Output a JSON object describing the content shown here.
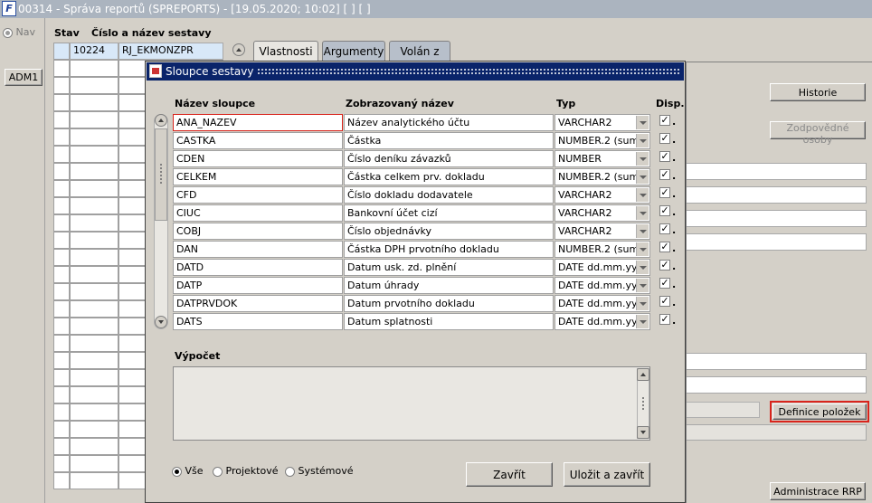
{
  "window": {
    "logo_text": "F",
    "title": "00314 - Správa reportů (SPREPORTS) - [19.05.2020; 10:02]  [ ]  [ ]"
  },
  "leftnav": {
    "nav_label": "Nav",
    "adm_button": "ADM1"
  },
  "report": {
    "col_stav": "Stav",
    "col_cislo": "Číslo a název sestavy",
    "number": "10224",
    "name": "RJ_EKMONZPR"
  },
  "tabs": [
    {
      "label": "Vlastnosti",
      "active": true
    },
    {
      "label": "Argumenty",
      "active": false
    },
    {
      "label": "Volán z",
      "active": false
    }
  ],
  "right_buttons": {
    "historie": "Historie",
    "zodpovedne": "Zodpovědné osoby",
    "definice": "Definice položek",
    "administrace": "Administrace RRP"
  },
  "dialog": {
    "title": "Sloupce sestavy",
    "headers": {
      "nazev": "Název sloupce",
      "zobrazovany": "Zobrazovaný název",
      "typ": "Typ",
      "disp": "Disp."
    },
    "rows": [
      {
        "col": "ANA_NAZEV",
        "label": "Název analytického účtu",
        "type": "VARCHAR2",
        "disp": true
      },
      {
        "col": "CASTKA",
        "label": "Částka",
        "type": "NUMBER.2  (sum)",
        "disp": true
      },
      {
        "col": "CDEN",
        "label": "Číslo deníku závazků",
        "type": "NUMBER",
        "disp": true
      },
      {
        "col": "CELKEM",
        "label": "Částka celkem prv. dokladu",
        "type": "NUMBER.2  (sum)",
        "disp": true
      },
      {
        "col": "CFD",
        "label": "Číslo dokladu dodavatele",
        "type": "VARCHAR2",
        "disp": true
      },
      {
        "col": "CIUC",
        "label": "Bankovní účet cizí",
        "type": "VARCHAR2",
        "disp": true
      },
      {
        "col": "COBJ",
        "label": "Číslo objednávky",
        "type": "VARCHAR2",
        "disp": true
      },
      {
        "col": "DAN",
        "label": "Částka DPH prvotního dokladu",
        "type": "NUMBER.2  (sum)",
        "disp": true
      },
      {
        "col": "DATD",
        "label": "Datum usk. zd. plnění",
        "type": "DATE dd.mm.yy...",
        "disp": true
      },
      {
        "col": "DATP",
        "label": "Datum úhrady",
        "type": "DATE dd.mm.yy...",
        "disp": true
      },
      {
        "col": "DATPRVDOK",
        "label": "Datum prvotního dokladu",
        "type": "DATE dd.mm.yy...",
        "disp": true
      },
      {
        "col": "DATS",
        "label": "Datum splatnosti",
        "type": "DATE dd.mm.yy...",
        "disp": true
      }
    ],
    "vypocet_label": "Výpočet",
    "vypocet_value": "",
    "filters": [
      {
        "label": "Vše",
        "selected": true
      },
      {
        "label": "Projektové",
        "selected": false
      },
      {
        "label": "Systémové",
        "selected": false
      }
    ],
    "zavrit": "Zavřít",
    "ulozit": "Uložit a zavřít"
  },
  "colors": {
    "title_bg": "#abb4bf",
    "dialog_title_bg": "#0a246a",
    "highlight_red": "#d9241c",
    "report_field_bg": "#d8e8f8"
  }
}
